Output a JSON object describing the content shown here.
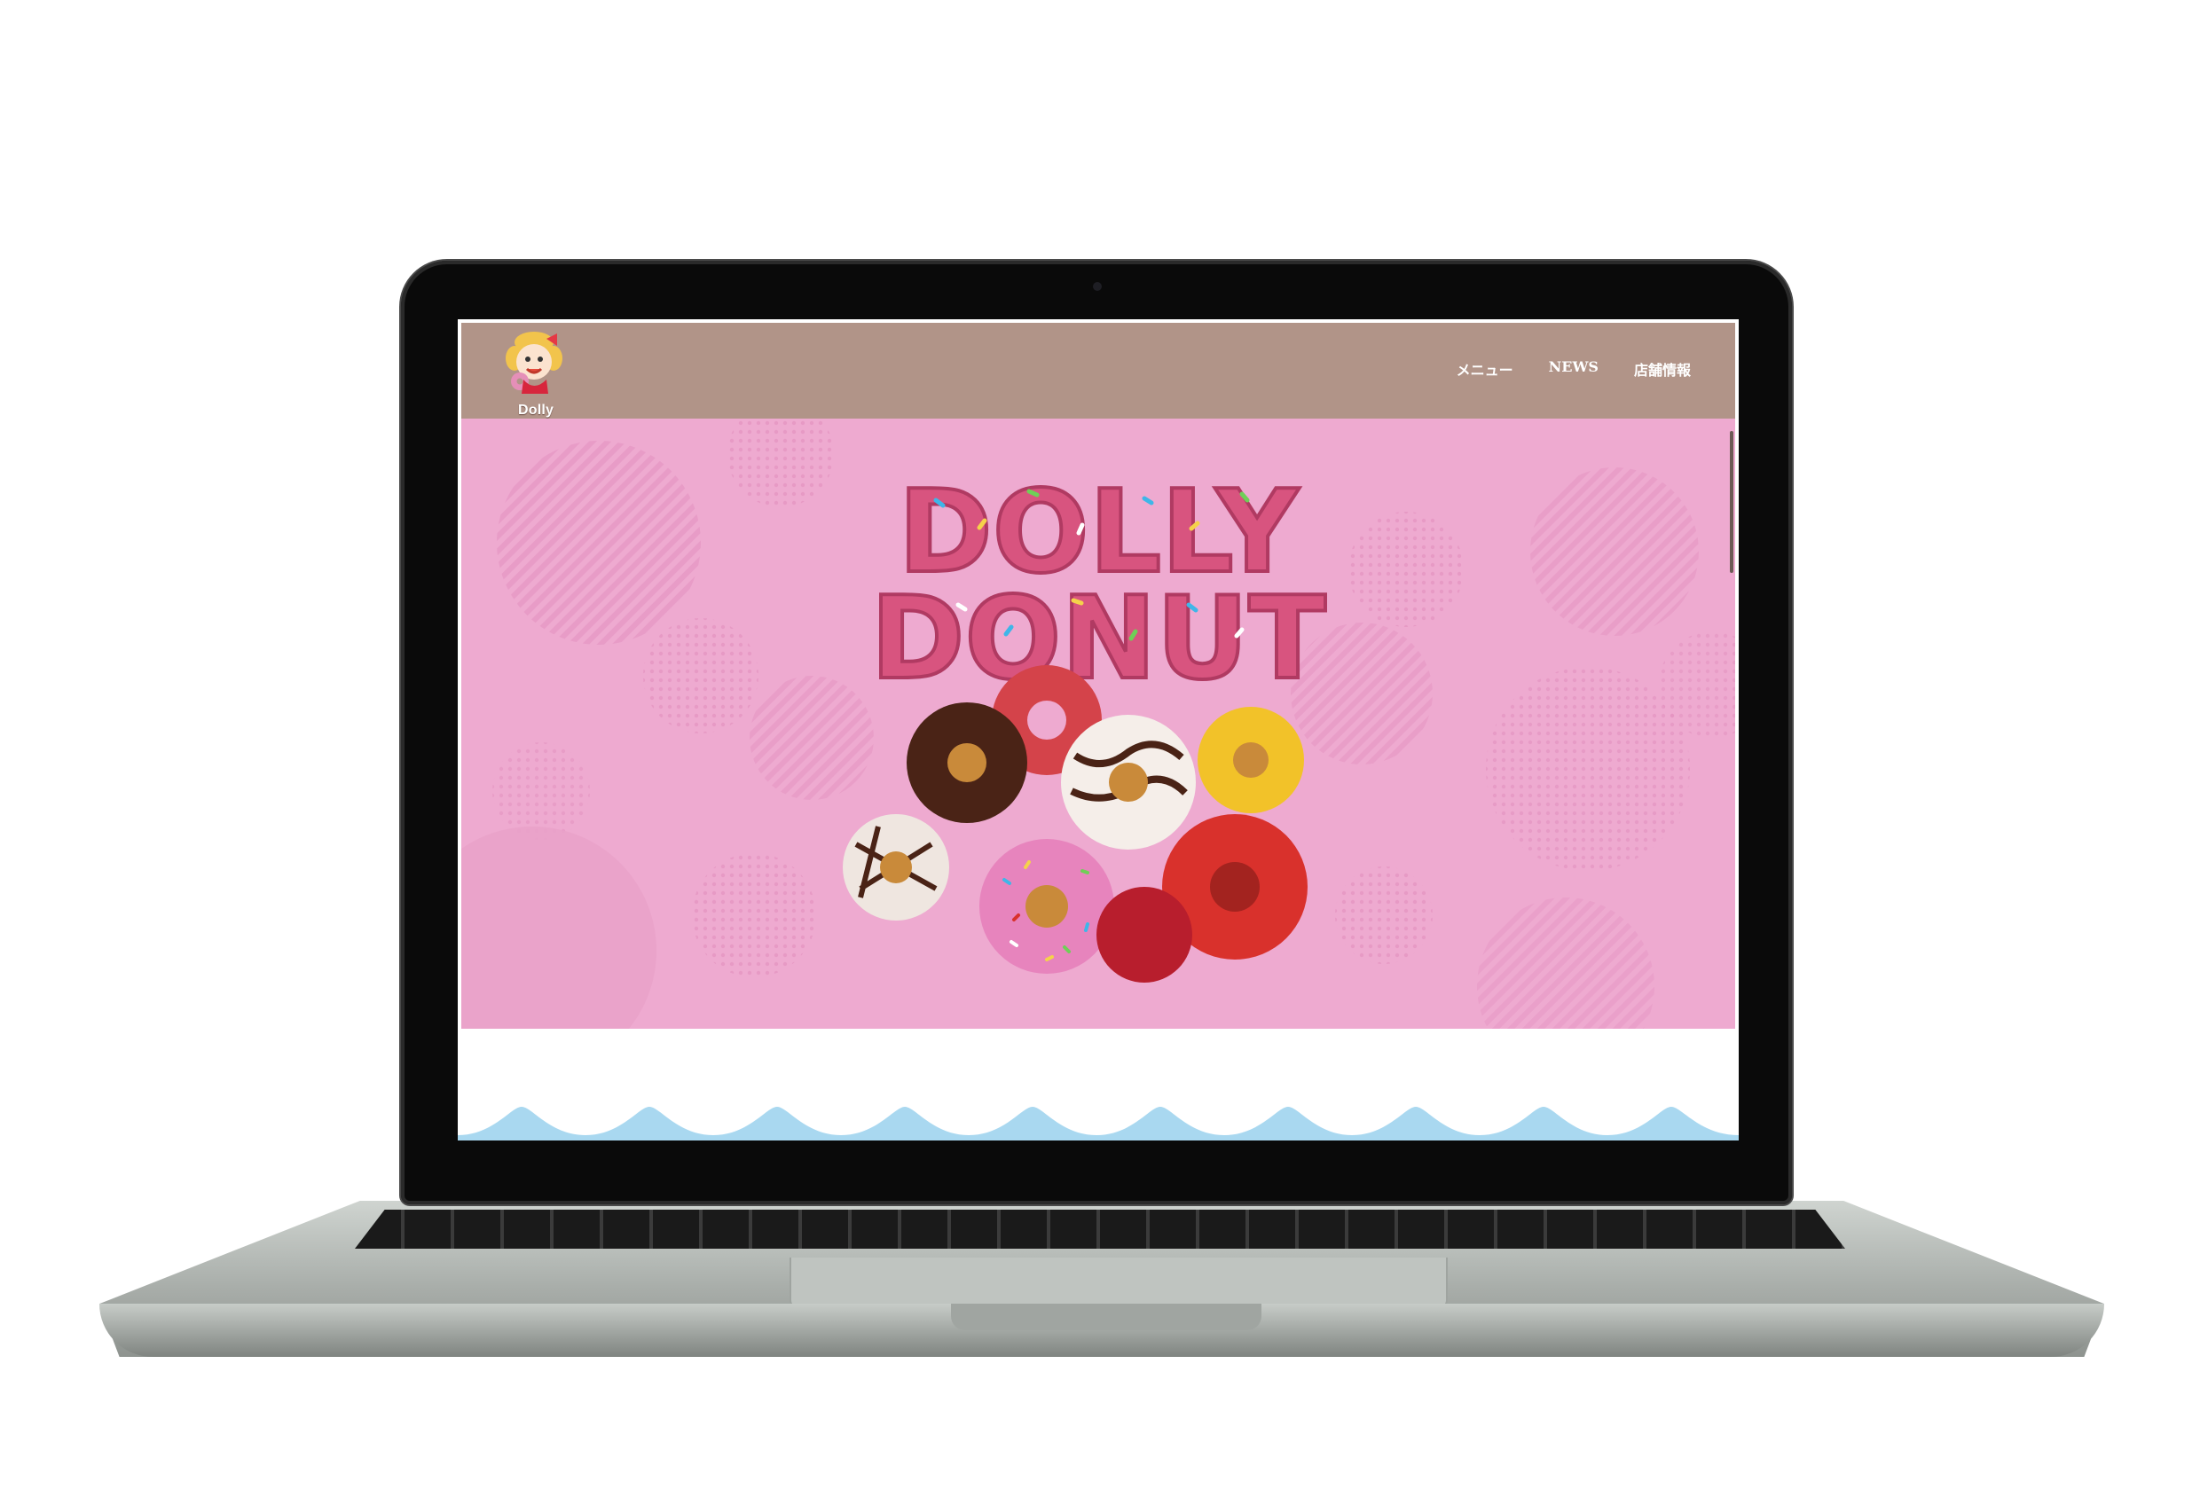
{
  "site": {
    "brand_name": "Dolly Donut",
    "nav": [
      "メニュー",
      "NEWS",
      "店舗情報"
    ],
    "hero_title_line1": "DOLLY",
    "hero_title_line2": "DONUT"
  },
  "colors": {
    "header": "#b19488",
    "hero_background": "#eeaad0",
    "wave": "#a9d8f0"
  },
  "icons": [
    "mascot-logo-icon",
    "donut-pile-illustration"
  ]
}
